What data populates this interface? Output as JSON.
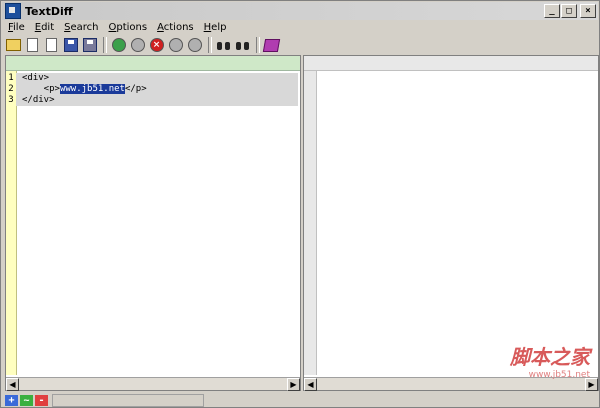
{
  "window": {
    "title": "TextDiff"
  },
  "menu": [
    {
      "accel": "F",
      "rest": "ile"
    },
    {
      "accel": "E",
      "rest": "dit"
    },
    {
      "accel": "S",
      "rest": "earch"
    },
    {
      "accel": "O",
      "rest": "ptions"
    },
    {
      "accel": "A",
      "rest": "ctions"
    },
    {
      "accel": "H",
      "rest": "elp"
    }
  ],
  "toolbar": {
    "icons": [
      "open-folder-icon",
      "new-doc-icon",
      "doc-icon",
      "save-icon",
      "save-as-icon",
      "refresh-icon",
      "stop-icon",
      "prev-icon",
      "next-icon",
      "find-icon",
      "find-next-icon",
      "help-book-icon"
    ]
  },
  "left": {
    "lines": [
      {
        "num": "1",
        "text": "<div>"
      },
      {
        "num": "2",
        "before": "    <p>",
        "selected": "www.jb51.net",
        "after": "</p>"
      },
      {
        "num": "3",
        "text": "</div>"
      }
    ]
  },
  "status": {
    "add": "+",
    "change": "~",
    "delete": "-"
  },
  "watermark": {
    "name": "脚本之家",
    "url": "www.jb51.net"
  },
  "colors": {
    "selection": "#1a3a9a",
    "left_header": "#cfe8c8",
    "gutter": "#ffffc0"
  }
}
